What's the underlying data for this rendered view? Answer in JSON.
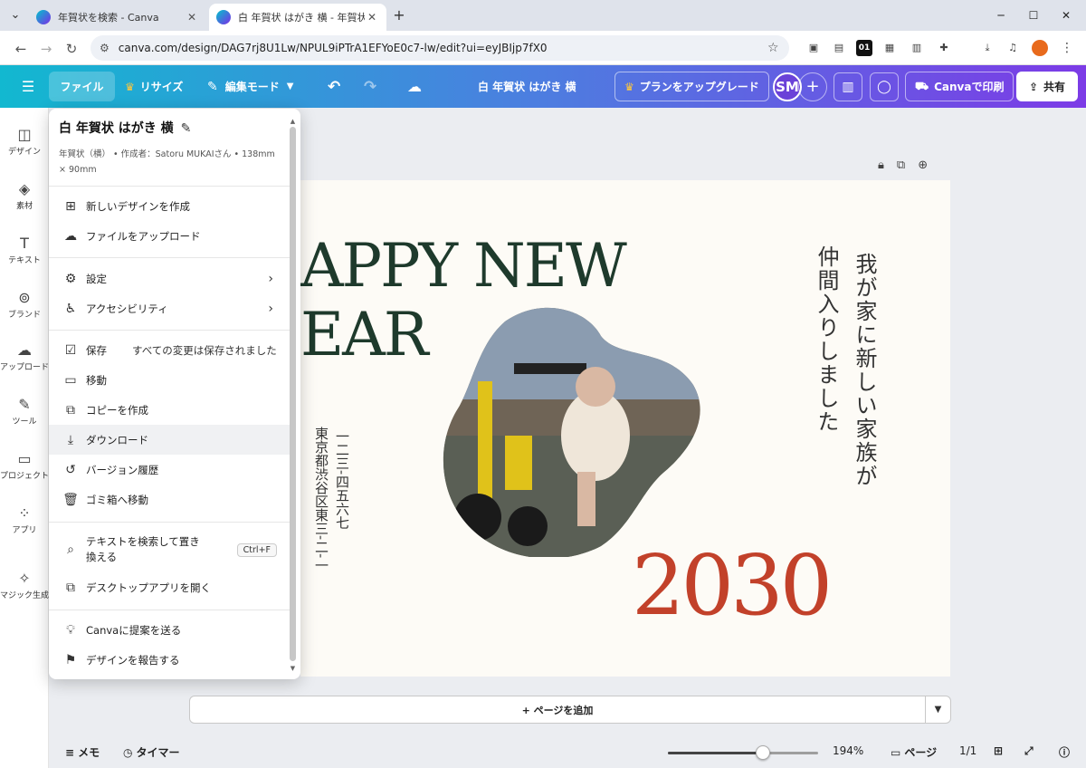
{
  "browser": {
    "tabs": [
      {
        "title": "年賀状を検索 - Canva",
        "active": false
      },
      {
        "title": "白 年賀状 はがき 横 - 年賀状",
        "active": true
      }
    ],
    "url": "canva.com/design/DAG7rj8U1Lw/NPUL9iPTrA1EFYoE0c7-lw/edit?ui=eyJBIjp7fX0",
    "ext_badge": "01"
  },
  "topbar": {
    "file_label": "ファイル",
    "resize_label": "リサイズ",
    "edit_mode_label": "編集モード",
    "doc_title": "白 年賀状 はがき 横",
    "upgrade_label": "プランをアップグレード",
    "avatar_initials": "SM",
    "print_label": "Canvaで印刷",
    "share_label": "共有"
  },
  "rail": [
    {
      "label": "デザイン",
      "icon": "layout-icon"
    },
    {
      "label": "素材",
      "icon": "elements-icon"
    },
    {
      "label": "テキスト",
      "icon": "text-icon"
    },
    {
      "label": "ブランド",
      "icon": "brand-icon"
    },
    {
      "label": "アップロード",
      "icon": "upload-icon"
    },
    {
      "label": "ツール",
      "icon": "tools-icon"
    },
    {
      "label": "プロジェクト",
      "icon": "folder-icon"
    },
    {
      "label": "アプリ",
      "icon": "apps-icon"
    },
    {
      "label": "マジック生成",
      "icon": "magic-icon"
    }
  ],
  "file_menu": {
    "title": "白 年賀状 はがき 横",
    "meta": "年賀状（横） • 作成者：Satoru MUKAIさん • 138mm × 90mm",
    "items": [
      {
        "label": "新しいデザインを作成",
        "icon": "new-design-icon"
      },
      {
        "label": "ファイルをアップロード",
        "icon": "upload-cloud-icon"
      },
      {
        "label": "設定",
        "icon": "gear-icon"
      },
      {
        "label": "アクセシビリティ",
        "icon": "accessibility-icon"
      },
      {
        "label": "保存",
        "icon": "cloud-check-icon",
        "note": "すべての変更は保存されました"
      },
      {
        "label": "移動",
        "icon": "folder-icon"
      },
      {
        "label": "コピーを作成",
        "icon": "copy-icon"
      },
      {
        "label": "ダウンロード",
        "icon": "download-icon"
      },
      {
        "label": "バージョン履歴",
        "icon": "history-icon"
      },
      {
        "label": "ゴミ箱へ移動",
        "icon": "trash-icon"
      },
      {
        "label": "テキストを検索して置き換える",
        "icon": "search-icon",
        "shortcut": "Ctrl+F"
      },
      {
        "label": "デスクトップアプリを開く",
        "icon": "external-link-icon"
      },
      {
        "label": "Canvaに提案を送る",
        "icon": "lightbulb-icon"
      },
      {
        "label": "デザインを報告する",
        "icon": "flag-icon"
      }
    ]
  },
  "design": {
    "headline_line1": "APPY NEW",
    "headline_line2": "EAR",
    "message_col1": "我が家に新しい家族が",
    "message_col2": "仲間入りしました",
    "address_col1": "一二三-四五六七",
    "address_col2": "東京都渋谷区東三-二-一",
    "year": "2030",
    "colors": {
      "headline": "#1e3a2c",
      "year": "#c2412a",
      "background": "#fdfbf6"
    }
  },
  "add_page_label": "+ ページを追加",
  "bottombar": {
    "memo_label": "メモ",
    "timer_label": "タイマー",
    "zoom_percent": 194,
    "zoom_label": "194%",
    "pages_label": "ページ",
    "page_count": "1/1"
  }
}
